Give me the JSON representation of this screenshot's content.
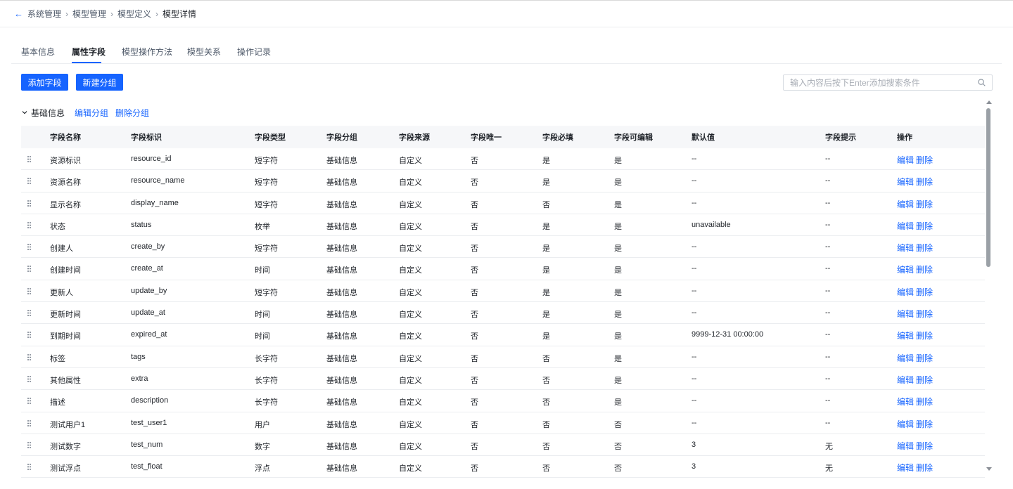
{
  "breadcrumb": [
    "系统管理",
    "模型管理",
    "模型定义",
    "模型详情"
  ],
  "tabs": [
    "基本信息",
    "属性字段",
    "模型操作方法",
    "模型关系",
    "操作记录"
  ],
  "active_tab": "属性字段",
  "toolbar": {
    "add_field": "添加字段",
    "new_group": "新建分组"
  },
  "search": {
    "placeholder": "输入内容后按下Enter添加搜索条件",
    "value": ""
  },
  "group": {
    "title": "基础信息",
    "edit": "编辑分组",
    "delete": "删除分组"
  },
  "columns": [
    "字段名称",
    "字段标识",
    "字段类型",
    "字段分组",
    "字段来源",
    "字段唯一",
    "字段必填",
    "字段可编辑",
    "默认值",
    "字段提示",
    "操作"
  ],
  "actions": {
    "edit": "编辑",
    "delete": "删除"
  },
  "rows": [
    [
      "资源标识",
      "resource_id",
      "短字符",
      "基础信息",
      "自定义",
      "否",
      "是",
      "是",
      "--",
      "--"
    ],
    [
      "资源名称",
      "resource_name",
      "短字符",
      "基础信息",
      "自定义",
      "否",
      "是",
      "是",
      "--",
      "--"
    ],
    [
      "显示名称",
      "display_name",
      "短字符",
      "基础信息",
      "自定义",
      "否",
      "否",
      "是",
      "--",
      "--"
    ],
    [
      "状态",
      "status",
      "枚举",
      "基础信息",
      "自定义",
      "否",
      "是",
      "是",
      "unavailable",
      "--"
    ],
    [
      "创建人",
      "create_by",
      "短字符",
      "基础信息",
      "自定义",
      "否",
      "是",
      "是",
      "--",
      "--"
    ],
    [
      "创建时间",
      "create_at",
      "时间",
      "基础信息",
      "自定义",
      "否",
      "是",
      "是",
      "--",
      "--"
    ],
    [
      "更新人",
      "update_by",
      "短字符",
      "基础信息",
      "自定义",
      "否",
      "是",
      "是",
      "--",
      "--"
    ],
    [
      "更新时间",
      "update_at",
      "时间",
      "基础信息",
      "自定义",
      "否",
      "是",
      "是",
      "--",
      "--"
    ],
    [
      "到期时间",
      "expired_at",
      "时间",
      "基础信息",
      "自定义",
      "否",
      "是",
      "是",
      "9999-12-31 00:00:00",
      "--"
    ],
    [
      "标签",
      "tags",
      "长字符",
      "基础信息",
      "自定义",
      "否",
      "否",
      "是",
      "--",
      "--"
    ],
    [
      "其他属性",
      "extra",
      "长字符",
      "基础信息",
      "自定义",
      "否",
      "否",
      "是",
      "--",
      "--"
    ],
    [
      "描述",
      "description",
      "长字符",
      "基础信息",
      "自定义",
      "否",
      "否",
      "是",
      "--",
      "--"
    ],
    [
      "测试用户1",
      "test_user1",
      "用户",
      "基础信息",
      "自定义",
      "否",
      "否",
      "否",
      "--",
      "--"
    ],
    [
      "测试数字",
      "test_num",
      "数字",
      "基础信息",
      "自定义",
      "否",
      "否",
      "否",
      "3",
      "无"
    ],
    [
      "测试浮点",
      "test_float",
      "浮点",
      "基础信息",
      "自定义",
      "否",
      "否",
      "否",
      "3",
      "无"
    ]
  ],
  "colors": {
    "accent": "#1664ff",
    "header_bg": "#f6f7f9",
    "border": "#ebedf0"
  }
}
